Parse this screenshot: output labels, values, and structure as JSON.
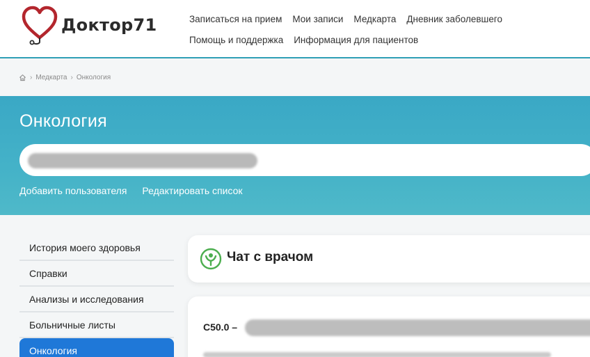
{
  "logo": {
    "text": "Доктор71",
    "icon": "heart-stethoscope-icon",
    "color": "#b3262d"
  },
  "nav": {
    "row1": [
      "Записаться на прием",
      "Мои записи",
      "Медкарта",
      "Дневник заболевшего"
    ],
    "row2": [
      "Помощь и поддержка",
      "Информация для пациентов"
    ]
  },
  "breadcrumb": {
    "home_icon": "home-icon",
    "items": [
      "Медкарта",
      "Онкология"
    ],
    "separator": "›"
  },
  "banner": {
    "title": "Онкология",
    "add_user": "Добавить пользователя",
    "edit_list": "Редактировать список",
    "color": "#3aa8c5"
  },
  "sidebar": {
    "items": [
      "История моего здоровья",
      "Справки",
      "Анализы и исследования",
      "Больничные листы",
      "Онкология"
    ],
    "active_index": 4,
    "active_color": "#1f78d8"
  },
  "chat": {
    "title": "Чат с врачом",
    "icon": "doctor-chat-icon"
  },
  "diagnosis": {
    "code": "C50.0 –"
  }
}
